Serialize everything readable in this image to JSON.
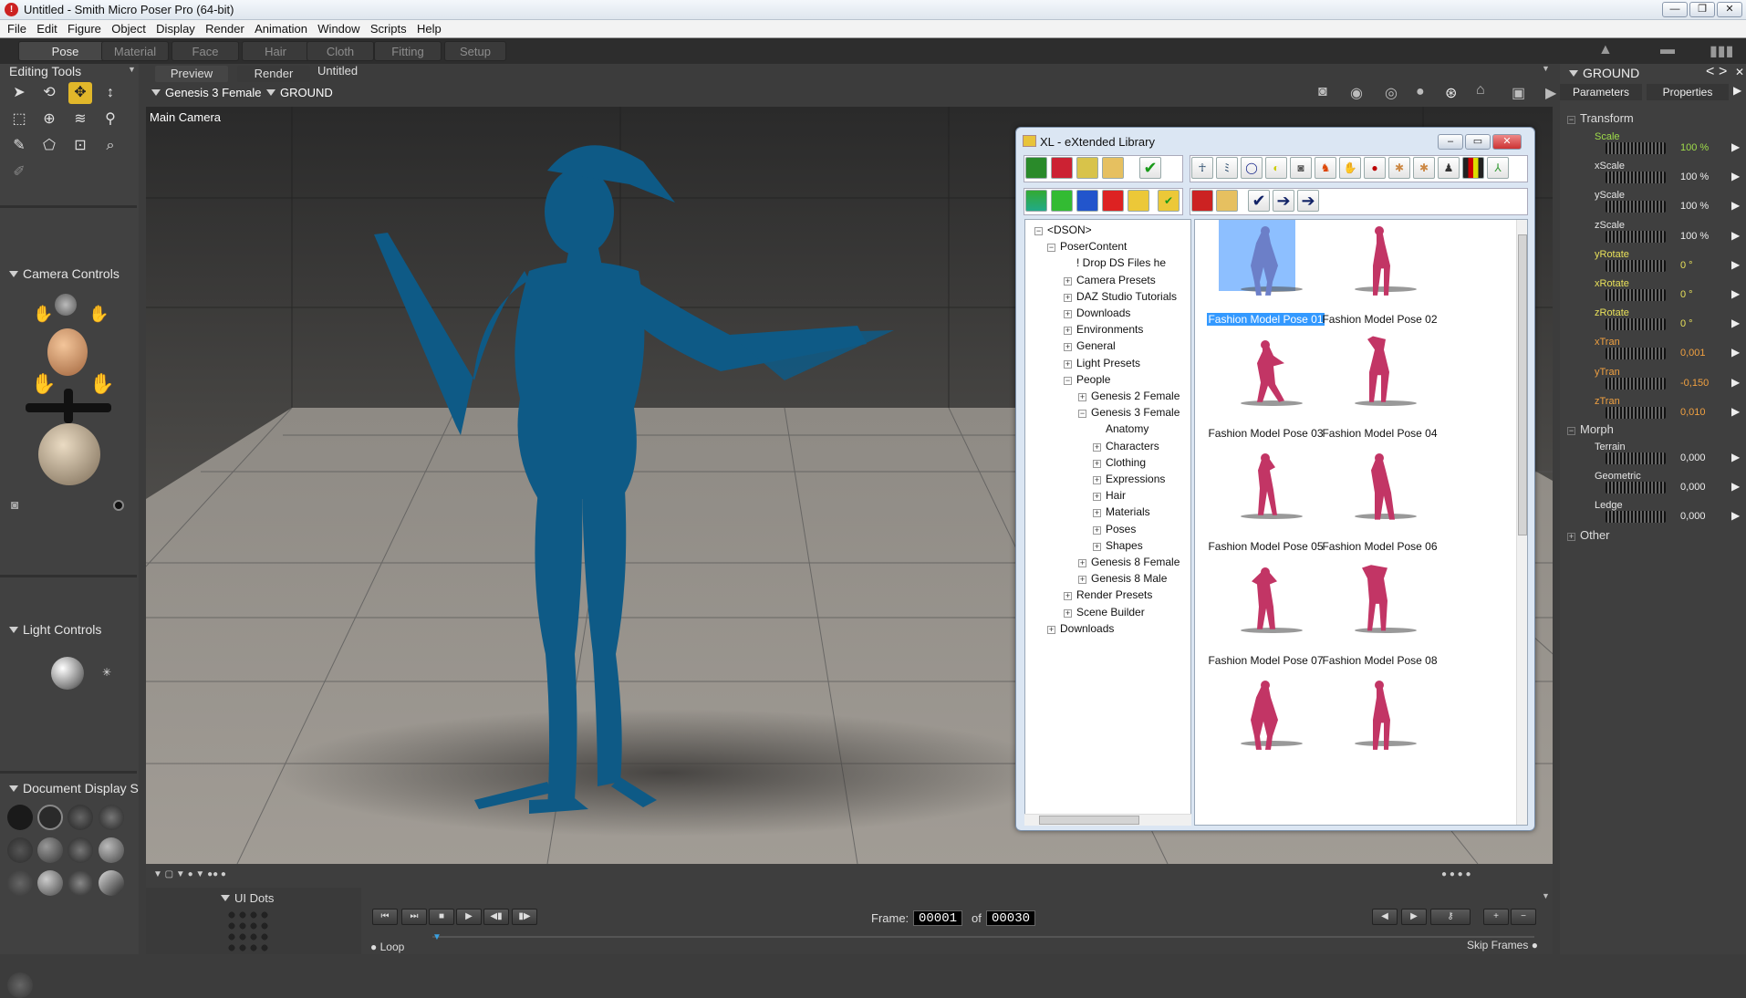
{
  "window": {
    "title": "Untitled - Smith Micro Poser Pro  (64-bit)",
    "btn_min": "—",
    "btn_max": "❐",
    "btn_close": "✕"
  },
  "menu": [
    "File",
    "Edit",
    "Figure",
    "Object",
    "Display",
    "Render",
    "Animation",
    "Window",
    "Scripts",
    "Help"
  ],
  "rooms": [
    "Pose",
    "Material",
    "Face",
    "Hair",
    "Cloth",
    "Fitting",
    "Setup"
  ],
  "left": {
    "editing_tools": "Editing Tools",
    "camera_controls": "Camera Controls",
    "light_controls": "Light Controls",
    "document_display": "Document Display S",
    "ui_dots": "UI Dots"
  },
  "viewport": {
    "tabs": [
      "Preview",
      "Render"
    ],
    "doc_title": "Untitled",
    "figure_select": "Genesis 3 Female",
    "actor_select": "GROUND",
    "camera_label": "Main Camera"
  },
  "xl": {
    "title": "XL - eXtended Library",
    "tree": [
      {
        "label": "<DSON>",
        "level": 0,
        "box": "−"
      },
      {
        "label": "PoserContent",
        "level": 1,
        "box": "−"
      },
      {
        "label": "!        Drop DS Files he",
        "level": 2,
        "box": ""
      },
      {
        "label": "Camera Presets",
        "level": 2,
        "box": "+"
      },
      {
        "label": "DAZ Studio Tutorials",
        "level": 2,
        "box": "+"
      },
      {
        "label": "Downloads",
        "level": 2,
        "box": "+"
      },
      {
        "label": "Environments",
        "level": 2,
        "box": "+"
      },
      {
        "label": "General",
        "level": 2,
        "box": "+"
      },
      {
        "label": "Light Presets",
        "level": 2,
        "box": "+"
      },
      {
        "label": "People",
        "level": 2,
        "box": "−"
      },
      {
        "label": "Genesis 2 Female",
        "level": 3,
        "box": "+"
      },
      {
        "label": "Genesis 3 Female",
        "level": 3,
        "box": "−"
      },
      {
        "label": "Anatomy",
        "level": 4,
        "box": ""
      },
      {
        "label": "Characters",
        "level": 4,
        "box": "+"
      },
      {
        "label": "Clothing",
        "level": 4,
        "box": "+"
      },
      {
        "label": "Expressions",
        "level": 4,
        "box": "+"
      },
      {
        "label": "Hair",
        "level": 4,
        "box": "+"
      },
      {
        "label": "Materials",
        "level": 4,
        "box": "+"
      },
      {
        "label": "Poses",
        "level": 4,
        "box": "+"
      },
      {
        "label": "Shapes",
        "level": 4,
        "box": "+"
      },
      {
        "label": "Genesis 8 Female",
        "level": 3,
        "box": "+"
      },
      {
        "label": "Genesis 8 Male",
        "level": 3,
        "box": "+"
      },
      {
        "label": "Render Presets",
        "level": 2,
        "box": "+"
      },
      {
        "label": "Scene Builder",
        "level": 2,
        "box": "+"
      },
      {
        "label": "Downloads",
        "level": 1,
        "box": "+"
      }
    ],
    "items": [
      "Fashion Model Pose 01",
      "Fashion Model Pose 02",
      "Fashion Model Pose 03",
      "Fashion Model Pose 04",
      "Fashion Model Pose 05",
      "Fashion Model Pose 06",
      "Fashion Model Pose 07",
      "Fashion Model Pose 08",
      "",
      ""
    ],
    "selected_item": "Fashion Model Pose 01"
  },
  "right": {
    "actor": "GROUND",
    "tabs": [
      "Parameters",
      "Properties"
    ],
    "groups": {
      "transform": "Transform",
      "morph": "Morph",
      "other": "Other"
    },
    "transform_params": [
      {
        "name": "Scale",
        "value": "100 %",
        "color": "#9fdc4a"
      },
      {
        "name": "xScale",
        "value": "100 %",
        "color": "#e6e6e6"
      },
      {
        "name": "yScale",
        "value": "100 %",
        "color": "#e6e6e6"
      },
      {
        "name": "zScale",
        "value": "100 %",
        "color": "#e6e6e6"
      },
      {
        "name": "yRotate",
        "value": "0 °",
        "color": "#e8e05a"
      },
      {
        "name": "xRotate",
        "value": "0 °",
        "color": "#e8e05a"
      },
      {
        "name": "zRotate",
        "value": "0 °",
        "color": "#e8e05a"
      },
      {
        "name": "xTran",
        "value": "0,001",
        "color": "#f0a040"
      },
      {
        "name": "yTran",
        "value": "-0,150",
        "color": "#f0a040"
      },
      {
        "name": "zTran",
        "value": "0,010",
        "color": "#f0a040"
      }
    ],
    "morph_params": [
      {
        "name": "Terrain",
        "value": "0,000",
        "color": "#e6e6e6"
      },
      {
        "name": "Geometric",
        "value": "0,000",
        "color": "#e6e6e6"
      },
      {
        "name": "Ledge",
        "value": "0,000",
        "color": "#e6e6e6"
      }
    ]
  },
  "timeline": {
    "frame_label": "Frame:",
    "frame_current": "00001",
    "of": "of",
    "frame_total": "00030",
    "loop": "Loop",
    "skip_frames": "Skip Frames"
  },
  "colors": {
    "figure": "#0e5a86",
    "thumb": "#c23565",
    "accent": "#e1b72a",
    "selection": "#3399ff"
  }
}
